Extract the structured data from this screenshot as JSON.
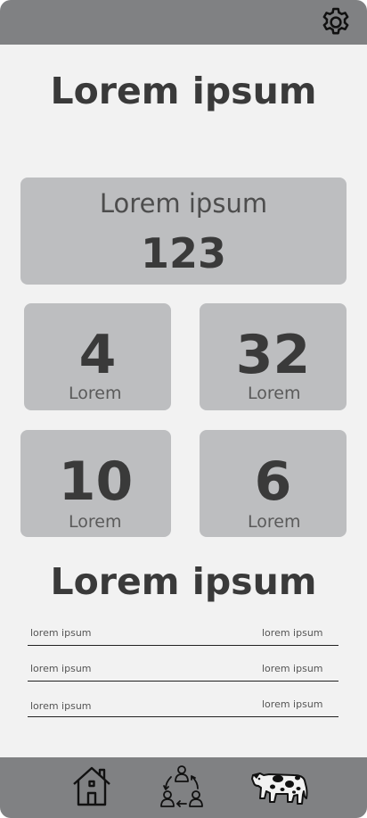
{
  "header": {
    "settings_icon": "gear-icon"
  },
  "main": {
    "title": "Lorem ipsum",
    "summary": {
      "label": "Lorem ipsum",
      "value": "123"
    },
    "stats": [
      {
        "value": "4",
        "label": "Lorem"
      },
      {
        "value": "32",
        "label": "Lorem"
      },
      {
        "value": "10",
        "label": "Lorem"
      },
      {
        "value": "6",
        "label": "Lorem"
      }
    ],
    "section_title": "Lorem ipsum",
    "rows": [
      {
        "left": "lorem ipsum",
        "right": "lorem ipsum"
      },
      {
        "left": "lorem ipsum",
        "right": "lorem ipsum"
      },
      {
        "left": "lorem ipsum",
        "right": "lorem ipsum"
      }
    ]
  },
  "bottom_nav": {
    "items": [
      "home-icon",
      "people-cycle-icon",
      "cow-icon"
    ]
  },
  "colors": {
    "bar": "#808183",
    "card": "#bdbec0",
    "background": "#f2f2f2",
    "text": "#3a3a3a"
  }
}
